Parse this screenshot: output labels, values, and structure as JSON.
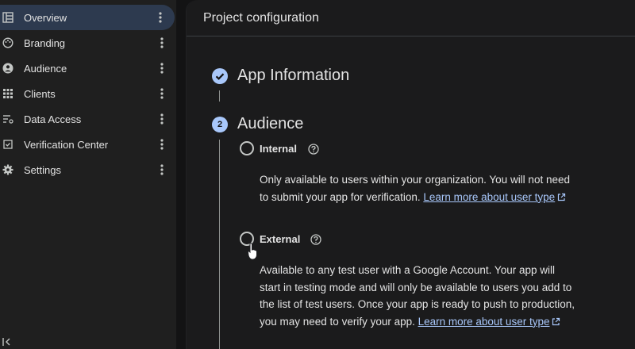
{
  "sidebar": {
    "items": [
      {
        "label": "Overview",
        "icon": "dashboard-icon",
        "active": true
      },
      {
        "label": "Branding",
        "icon": "palette-icon",
        "active": false
      },
      {
        "label": "Audience",
        "icon": "person-icon",
        "active": false
      },
      {
        "label": "Clients",
        "icon": "grid-icon",
        "active": false
      },
      {
        "label": "Data Access",
        "icon": "filter-list-icon",
        "active": false
      },
      {
        "label": "Verification Center",
        "icon": "verified-icon",
        "active": false
      },
      {
        "label": "Settings",
        "icon": "gear-icon",
        "active": false
      }
    ]
  },
  "main": {
    "header_title": "Project configuration",
    "step1": {
      "title": "App Information"
    },
    "step2": {
      "number": "2",
      "title": "Audience",
      "internal": {
        "label": "Internal",
        "desc": "Only available to users within your organization. You will not need to submit your app for verification. ",
        "link": "Learn more about user type"
      },
      "external": {
        "label": "External",
        "desc": "Available to any test user with a Google Account. Your app will start in testing mode and will only be available to users you add to the list of test users. Once your app is ready to push to production, you may need to verify your app. ",
        "link": "Learn more about user type"
      }
    }
  },
  "colors": {
    "accent": "#a8c7fa",
    "active_bg": "#2d3a4f",
    "sidebar_bg": "#1f1f1f",
    "main_bg": "#1b1b1c"
  }
}
